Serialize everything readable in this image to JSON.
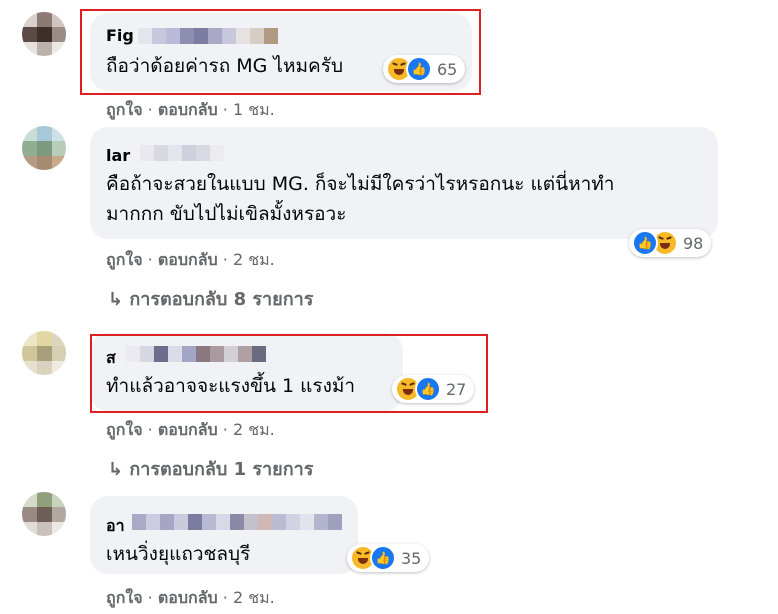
{
  "colors": {
    "bubble": "#f0f2f5",
    "secondary_text": "#65676b",
    "highlight_box": "#e02020",
    "like_blue": "#1877f2",
    "haha_yellow": "#f7b928"
  },
  "comments": [
    {
      "name": "Fig",
      "text_lines": [
        "ถือว่าด้อยค่ารถ MG ไหมครับ"
      ],
      "reaction_icons": [
        "haha-icon",
        "like-icon"
      ],
      "reaction_count": "65",
      "like_label": "ถูกใจ",
      "reply_label": "ตอบกลับ",
      "sep": "·",
      "time": "1 ชม."
    },
    {
      "name": "lar",
      "text_lines": [
        "คือถ้าจะสวยในแบบ MG. ก็จะไม่มีใครว่าไรหรอกนะ แต่นี่หาทำ",
        "มากกก ขับไปไม่เขิลมั้งหรอวะ"
      ],
      "reaction_icons": [
        "like-icon",
        "haha-icon"
      ],
      "reaction_count": "98",
      "like_label": "ถูกใจ",
      "reply_label": "ตอบกลับ",
      "sep": "·",
      "time": "2 ชม.",
      "replies_label": "การตอบกลับ 8 รายการ"
    },
    {
      "name": "ส",
      "text_lines": [
        "ทำแล้วอาจจะแรงขึ้น 1 แรงม้า"
      ],
      "reaction_icons": [
        "haha-icon",
        "like-icon"
      ],
      "reaction_count": "27",
      "like_label": "ถูกใจ",
      "reply_label": "ตอบกลับ",
      "sep": "·",
      "time": "2 ชม.",
      "replies_label": "การตอบกลับ 1 รายการ"
    },
    {
      "name": "อา",
      "text_lines": [
        "เหนวิ่งยุแถวชลบุรี"
      ],
      "reaction_icons": [
        "haha-icon",
        "like-icon"
      ],
      "reaction_count": "35",
      "like_label": "ถูกใจ",
      "reply_label": "ตอบกลับ",
      "sep": "·",
      "time": "2 ชม."
    }
  ]
}
